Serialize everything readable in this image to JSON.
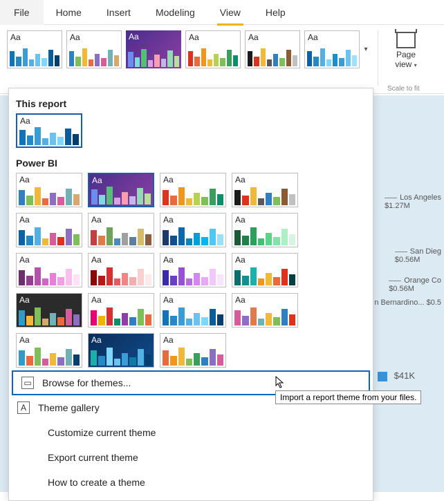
{
  "menubar": [
    "File",
    "Home",
    "Insert",
    "Modeling",
    "View",
    "Help"
  ],
  "activeMenu": 4,
  "ribbon": {
    "pageViewLabel": "Page",
    "pageViewLabel2": "view",
    "scaleLabel": "Scale to fit"
  },
  "aa": "Aa",
  "themeStrip": [
    {
      "colors": [
        "#1173b8",
        "#2588c7",
        "#3c9dd6",
        "#52b0e3",
        "#6ac3ef",
        "#80d6fb",
        "#0a5d9a",
        "#063f6d"
      ]
    },
    {
      "colors": [
        "#2f7fc1",
        "#7fbf59",
        "#f0b93a",
        "#e86a3e",
        "#8d6fc1",
        "#d85b9c",
        "#6fb1b5",
        "#d6a86b"
      ]
    },
    {
      "colors": [
        "#6d8cf0",
        "#7fd9e3",
        "#53c076",
        "#d9a2e3",
        "#f79fb1",
        "#c4b6e7",
        "#94d9b6",
        "#b7e09a"
      ],
      "selected": true
    },
    {
      "colors": [
        "#e0311c",
        "#e86a3e",
        "#f0961c",
        "#f0b93a",
        "#b7d150",
        "#7fbf59",
        "#38a05c",
        "#0a8f6a"
      ]
    },
    {
      "colors": [
        "#1b1b1b",
        "#e0311c",
        "#f0b93a",
        "#595959",
        "#2f7fc1",
        "#7fbf59",
        "#8a5b36",
        "#c0c0c0"
      ]
    },
    {
      "colors": [
        "#0a63a8",
        "#2588c7",
        "#52b0e3",
        "#80d6fb",
        "#1c8fca",
        "#3c9dd6",
        "#6ac3ef",
        "#9fe0fb"
      ]
    }
  ],
  "dropdown": {
    "section1": "This report",
    "section2": "Power BI",
    "currentTheme": {
      "colors": [
        "#1173b8",
        "#2588c7",
        "#3c9dd6",
        "#52b0e3",
        "#6ac3ef",
        "#80d6fb",
        "#0a5d9a",
        "#063f6d"
      ]
    },
    "themes": [
      [
        {
          "colors": [
            "#2f7fc1",
            "#7fbf59",
            "#f0b93a",
            "#e86a3e",
            "#8d6fc1",
            "#d85b9c",
            "#6fb1b5",
            "#d6a86b"
          ]
        },
        {
          "colors": [
            "#6d8cf0",
            "#7fd9e3",
            "#53c076",
            "#d9a2e3",
            "#f79fb1",
            "#c4b6e7",
            "#94d9b6",
            "#b7e09a"
          ],
          "selected": true,
          "bg": "purple"
        },
        {
          "colors": [
            "#e0311c",
            "#e86a3e",
            "#f0961c",
            "#f0b93a",
            "#b7d150",
            "#7fbf59",
            "#38a05c",
            "#0a8f6a"
          ]
        },
        {
          "colors": [
            "#1b1b1b",
            "#e0311c",
            "#f0b93a",
            "#595959",
            "#2f7fc1",
            "#7fbf59",
            "#8a5b36",
            "#c0c0c0"
          ]
        },
        {
          "colors": [
            "#0a63a8",
            "#2588c7",
            "#52b0e3",
            "#f0b93a",
            "#d85b9c",
            "#e0311c",
            "#8d6fc1",
            "#7fbf59"
          ]
        }
      ],
      [
        {
          "colors": [
            "#c44040",
            "#e07c4b",
            "#6fa35a",
            "#4a8abf",
            "#a0a0a0",
            "#5d7ea0",
            "#d4bd6a",
            "#8b5e3c"
          ]
        },
        {
          "colors": [
            "#1c3a6e",
            "#11508c",
            "#0d69ab",
            "#0983c4",
            "#059ddc",
            "#00b7f3",
            "#4dc8f5",
            "#9ae0f9"
          ]
        },
        {
          "colors": [
            "#1b5a36",
            "#227f4a",
            "#2aa05c",
            "#3fc174",
            "#5ad48a",
            "#82e3a8",
            "#aeefc6",
            "#d7f5e1"
          ]
        },
        {
          "colors": [
            "#6d2f6e",
            "#923f8f",
            "#b650ad",
            "#d463c7",
            "#e57fd7",
            "#f19ee4",
            "#f9c0ef",
            "#fce1f7"
          ]
        },
        {
          "colors": [
            "#8c0808",
            "#b71919",
            "#d63030",
            "#e85a5a",
            "#f08585",
            "#f5adad",
            "#f9d0d0",
            "#fce9e9"
          ]
        }
      ],
      [
        {
          "colors": [
            "#3a2ba8",
            "#6a3fc1",
            "#9650d6",
            "#b66ae3",
            "#d187ef",
            "#e6a8f7",
            "#f2c7fb",
            "#f9e4fd"
          ]
        },
        {
          "colors": [
            "#0a6e6e",
            "#12908e",
            "#1ab0ab",
            "#f0961c",
            "#f0b93a",
            "#e86a3e",
            "#e0311c",
            "#063f3f"
          ]
        },
        {
          "colors": [
            "#2f9bc7",
            "#f0b93a",
            "#7fbf59",
            "#d6a86b",
            "#6fb1b5",
            "#e86a3e",
            "#d85b9c",
            "#8d6fc1"
          ],
          "bg": "dark"
        },
        {
          "colors": [
            "#e60073",
            "#f2b300",
            "#d63030",
            "#0a8f6a",
            "#8d3fa3",
            "#2f7fc1",
            "#7fbf59",
            "#e86a3e"
          ]
        },
        {
          "colors": [
            "#1173b8",
            "#2588c7",
            "#3c9dd6",
            "#52b0e3",
            "#6ac3ef",
            "#80d6fb",
            "#0a5d9a",
            "#063f6d"
          ]
        }
      ],
      [
        {
          "colors": [
            "#d85b9c",
            "#8d6fc1",
            "#e07c4b",
            "#6fb1b5",
            "#f0b93a",
            "#7fbf59",
            "#2f7fc1",
            "#e0311c"
          ]
        },
        {
          "colors": [
            "#2f9bc7",
            "#e86a3e",
            "#7fbf59",
            "#d85b9c",
            "#f0b93a",
            "#8d6fc1",
            "#6fb1b5",
            "#063f6d"
          ]
        },
        {
          "colors": [
            "#1ab0ab",
            "#2588c7",
            "#80d6fb",
            "#6ac3ef",
            "#3c9dd6",
            "#0e7aa8",
            "#52b0e3",
            "#063f6d"
          ],
          "bg": "navy"
        },
        {
          "colors": [
            "#e86a3e",
            "#f0961c",
            "#f0b93a",
            "#7fbf59",
            "#38a05c",
            "#2f7fc1",
            "#8d6fc1",
            "#d85b9c"
          ]
        }
      ]
    ],
    "browse": "Browse for themes...",
    "gallery": "Theme gallery",
    "customize": "Customize current theme",
    "export": "Export current theme",
    "howto": "How to create a theme"
  },
  "tooltip": "Import a report theme from your files.",
  "report": {
    "callouts": [
      {
        "label": "Los Angeles",
        "value": "$1.27M"
      },
      {
        "label": "San Dieg",
        "value": "$0.56M"
      },
      {
        "label": "Orange Co",
        "value": "$0.56M"
      },
      {
        "label": "n Bernardino...",
        "value": "$0.5"
      }
    ],
    "amount": "$41K"
  }
}
